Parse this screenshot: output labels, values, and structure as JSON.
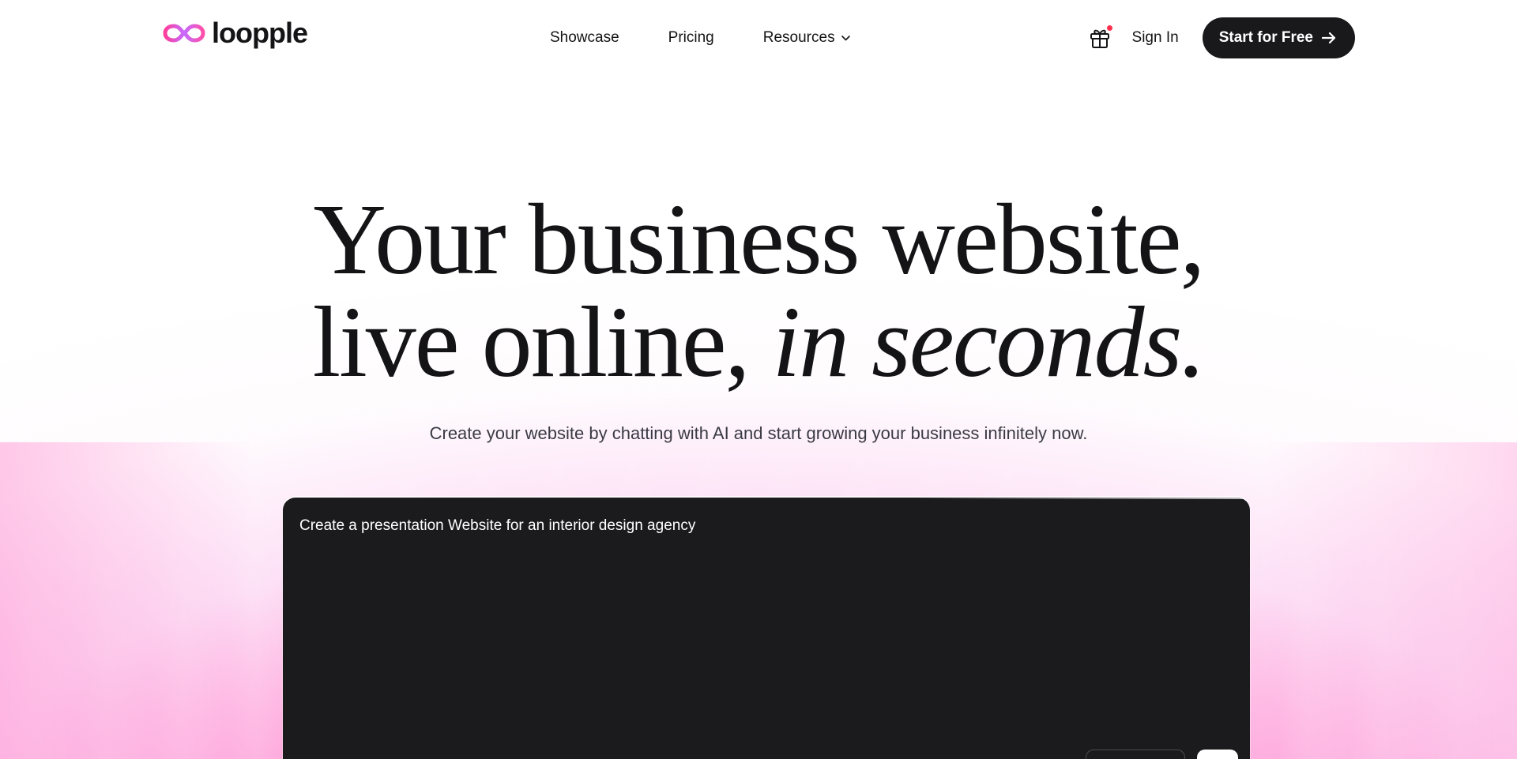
{
  "brand": {
    "name": "loopple"
  },
  "nav": {
    "items": [
      {
        "label": "Showcase"
      },
      {
        "label": "Pricing"
      },
      {
        "label": "Resources",
        "has_dropdown": true,
        "dropdown_icon": "chevron-down-icon"
      }
    ]
  },
  "header_actions": {
    "gift_icon": "gift-icon",
    "gift_notification": true,
    "signin_label": "Sign In",
    "cta_label": "Start for Free",
    "cta_icon": "arrow-right-icon"
  },
  "hero": {
    "title_line1": "Your business website,",
    "title_line2_regular": "live online, ",
    "title_line2_italic": "in seconds.",
    "subtitle": "Create your website by chatting with AI and start growing your business infinitely now."
  },
  "prompt": {
    "value": "Create a presentation Website for an interior design agency"
  },
  "colors": {
    "text": "#141416",
    "cta_bg": "#19191b",
    "prompt_bg": "#1b1b1e",
    "glow_pink": "#ff4ab0",
    "notification_dot": "#ff2f4d"
  }
}
